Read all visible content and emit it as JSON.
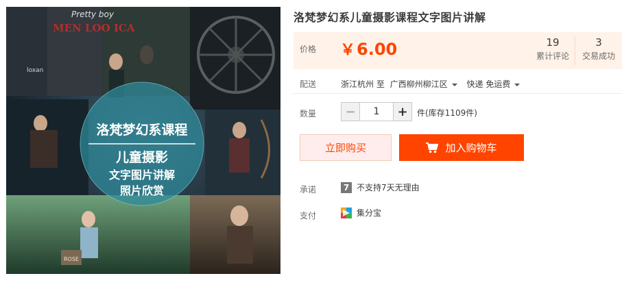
{
  "product": {
    "title": "洛梵梦幻系儿童摄影课程文字图片讲解",
    "image": {
      "header_script": "Pretty boy",
      "header_gothic": "MEN LOO ICA",
      "side_text": "loxan",
      "circle_line1": "洛梵梦幻系课程",
      "circle_line2": "儿童摄影",
      "circle_line3": "文字图片讲解",
      "circle_line4": "照片欣赏",
      "book_text": "ROSE"
    }
  },
  "price": {
    "label": "价格",
    "currency": "￥",
    "value": "6.00",
    "accent_color": "#ff4400"
  },
  "stats": {
    "reviews_count": "19",
    "reviews_label": "累计评论",
    "deals_count": "3",
    "deals_label": "交易成功"
  },
  "delivery": {
    "label": "配送",
    "from": "浙江杭州 至",
    "to": "广西柳州柳江区",
    "method": "快递 免运费"
  },
  "quantity": {
    "label": "数量",
    "minus": "−",
    "plus": "+",
    "value": "1",
    "stock": "件(库存1109件)"
  },
  "buttons": {
    "buy_now": "立即购买",
    "add_to_cart": "加入购物车"
  },
  "promise": {
    "label": "承诺",
    "badge": "7",
    "text": "不支持7天无理由"
  },
  "payment": {
    "label": "支付",
    "method": "集分宝",
    "icon": "jifenbao-icon"
  }
}
